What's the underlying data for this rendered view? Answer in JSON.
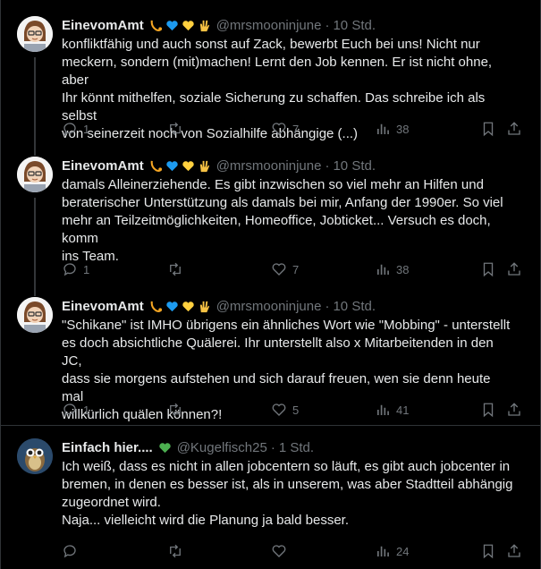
{
  "tweets": [
    {
      "name": "EinevomAmt",
      "badges": [
        "horn",
        "blue-heart",
        "yellow-heart",
        "vulcan-salute"
      ],
      "handle": "@mrsmooninjune",
      "time": "10 Std.",
      "lines": [
        "konfliktfähig und auch sonst auf Zack, bewerbt Euch bei uns! Nicht nur",
        "meckern, sondern (mit)machen! Lernt den Job kennen. Er ist nicht ohne, aber",
        "Ihr könnt mithelfen, soziale Sicherung zu schaffen. Das schreibe ich als selbst",
        "von seinerzeit noch von Sozialhilfe abhängige (...)"
      ],
      "replies": "1",
      "retweets": "",
      "likes": "7",
      "views": "38"
    },
    {
      "name": "EinevomAmt",
      "badges": [
        "horn",
        "blue-heart",
        "yellow-heart",
        "vulcan-salute"
      ],
      "handle": "@mrsmooninjune",
      "time": "10 Std.",
      "lines": [
        "damals Alleinerziehende. Es gibt inzwischen so viel mehr an Hilfen und",
        "beraterischer Unterstützung als damals bei mir, Anfang der 1990er. So viel",
        "mehr an Teilzeitmöglichkeiten, Homeoffice, Jobticket... Versuch es doch, komm",
        "ins Team."
      ],
      "replies": "1",
      "retweets": "",
      "likes": "7",
      "views": "38"
    },
    {
      "name": "EinevomAmt",
      "badges": [
        "horn",
        "blue-heart",
        "yellow-heart",
        "vulcan-salute"
      ],
      "handle": "@mrsmooninjune",
      "time": "10 Std.",
      "lines": [
        "\"Schikane\" ist IMHO übrigens ein ähnliches Wort wie \"Mobbing\"  - unterstellt",
        "es doch absichtliche Quälerei.  Ihr unterstellt also x Mitarbeitenden in den JC,",
        "dass sie morgens aufstehen und sich darauf freuen, wen sie denn heute mal",
        "willkürlich quälen können?!"
      ],
      "replies": "1",
      "retweets": "",
      "likes": "5",
      "views": "41"
    },
    {
      "name": "Einfach hier....",
      "badges": [
        "green-heart"
      ],
      "handle": "@Kugelfisch25",
      "time": "1 Std.",
      "lines": [
        "Ich weiß, dass es nicht in allen jobcentern so läuft, es gibt auch jobcenter in",
        "bremen, in denen es besser ist, als in unserem, was aber Stadtteil abhängig",
        "zugeordnet wird.",
        "Naja... vielleicht wird die Planung ja bald besser."
      ],
      "replies": "",
      "retweets": "",
      "likes": "",
      "views": "24"
    }
  ],
  "dot": "·",
  "colors": {
    "background": "#000000",
    "text": "#e7e9ea",
    "muted": "#71767b",
    "divider": "#2f3336",
    "heart_blue": "#1d9bf0",
    "heart_yellow": "#ffd03f",
    "heart_green": "#4caf50",
    "salute": "#f6c244"
  }
}
